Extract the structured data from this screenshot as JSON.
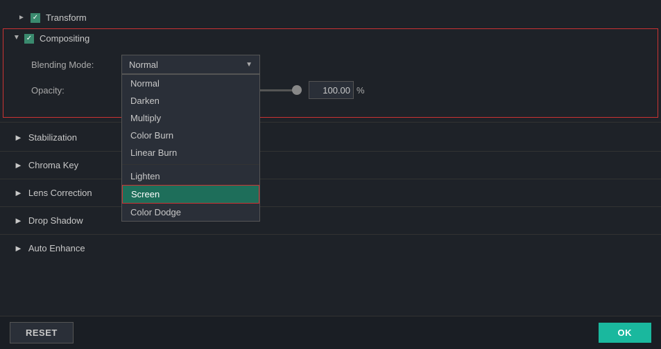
{
  "sections": {
    "transform": {
      "label": "Transform",
      "checked": true,
      "expanded": false
    },
    "compositing": {
      "label": "Compositing",
      "checked": true,
      "expanded": true
    }
  },
  "compositing_form": {
    "blending_mode_label": "Blending Mode:",
    "opacity_label": "Opacity:",
    "selected_mode": "Normal",
    "opacity_value": "100.00",
    "opacity_unit": "%",
    "dropdown_items": [
      "Normal",
      "Darken",
      "Multiply",
      "Color Burn",
      "Linear Burn",
      "Lighten",
      "Screen",
      "Color Dodge"
    ],
    "selected_dropdown_item": "Screen"
  },
  "bottom_sections": [
    {
      "label": "Stabilization",
      "checked": false
    },
    {
      "label": "Chroma Key",
      "checked": false
    },
    {
      "label": "Lens Correction",
      "checked": false
    },
    {
      "label": "Drop Shadow",
      "checked": false
    },
    {
      "label": "Auto Enhance",
      "checked": false
    }
  ],
  "footer": {
    "reset_label": "RESET",
    "ok_label": "OK"
  }
}
